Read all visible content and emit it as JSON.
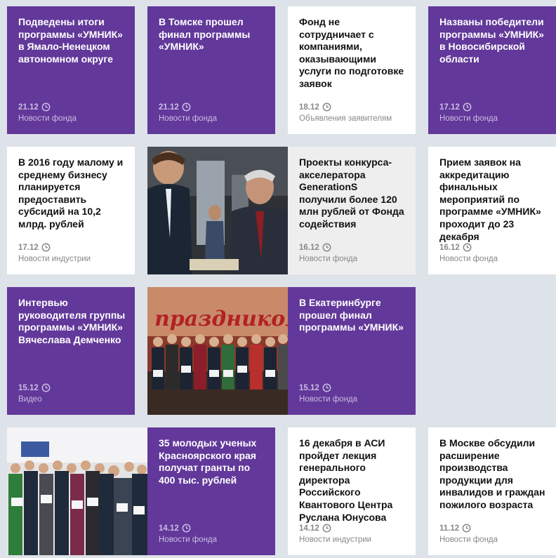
{
  "tiles": [
    {
      "title": "Подведены итоги программы «УМНИК» в Ямало-Ненецком автономном округе",
      "date": "21.12",
      "category": "Новости фонда"
    },
    {
      "title": "В Томске прошел финал программы «УМНИК»",
      "date": "21.12",
      "category": "Новости фонда"
    },
    {
      "title": "Фонд не сотрудничает с компаниями, оказывающими услуги по подготовке заявок",
      "date": "18.12",
      "category": "Объявления заявителям"
    },
    {
      "title": "Названы победители программы «УМНИК» в Новосибирской области",
      "date": "17.12",
      "category": "Новости фонда"
    },
    {
      "title": "В 2016 году малому и среднему бизнесу планируется предоставить субсидий на 10,2 млрд. рублей",
      "date": "17.12",
      "category": "Новости индустрии"
    },
    {
      "title": "Проекты конкурса-акселератора GenerationS получили более 120 млн рублей от Фонда содействия",
      "date": "16.12",
      "category": "Новости фонда"
    },
    {
      "title": "Прием заявок на аккредитацию финальных мероприятий по программе «УМНИК» проходит до 23 декабря",
      "date": "16.12",
      "category": "Новости фонда"
    },
    {
      "title": "Интервью руководителя группы программы «УМНИК» Вячеслава Демченко",
      "date": "15.12",
      "category": "Видео"
    },
    {
      "title": "В Екатеринбурге прошел финал программы «УМНИК»",
      "date": "15.12",
      "category": "Новости фонда"
    },
    {
      "title": "35 молодых ученых Красноярского края получат гранты по 400 тыс. рублей",
      "date": "14.12",
      "category": "Новости фонда"
    },
    {
      "title": "16 декабря в АСИ пройдет лекция генерального директора Российского Квантового Центра Руслана Юнусова",
      "date": "14.12",
      "category": "Новости индустрии"
    },
    {
      "title": "В Москве обсудили расширение производства продукции для инвалидов и граждан пожилого возраста",
      "date": "11.12",
      "category": "Новости фонда"
    }
  ],
  "photos": {
    "ekb_banner": "праздником"
  },
  "icons": {
    "clock": "clock-icon"
  },
  "colors": {
    "purple": "#62389a",
    "background": "#dde3e8"
  }
}
